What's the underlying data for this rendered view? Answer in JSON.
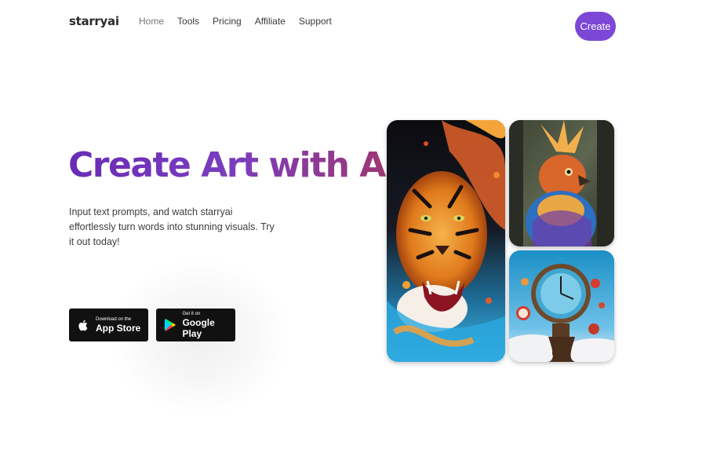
{
  "nav": {
    "logo": "starryai",
    "links": [
      "Home",
      "Tools",
      "Pricing",
      "Affiliate",
      "Support"
    ],
    "create_label": "Create"
  },
  "hero": {
    "title": "Create Art with AI",
    "subtitle": "Input text prompts, and watch starryai effortlessly turn words into stunning visuals. Try it out today!",
    "app_store": {
      "small": "Download on the",
      "big": "App Store"
    },
    "google_play": {
      "small": "Get it on",
      "big": "Google Play"
    }
  },
  "colors": {
    "accent": "#7c47d6",
    "title_gradient": [
      "#6a2cb5",
      "#a0366e"
    ],
    "store_button_bg": "#111111"
  },
  "gallery": [
    {
      "name": "tiger-artwork",
      "icon": "tiger-image"
    },
    {
      "name": "bird-artwork",
      "icon": "bird-image"
    },
    {
      "name": "clock-artwork",
      "icon": "clock-image"
    }
  ]
}
